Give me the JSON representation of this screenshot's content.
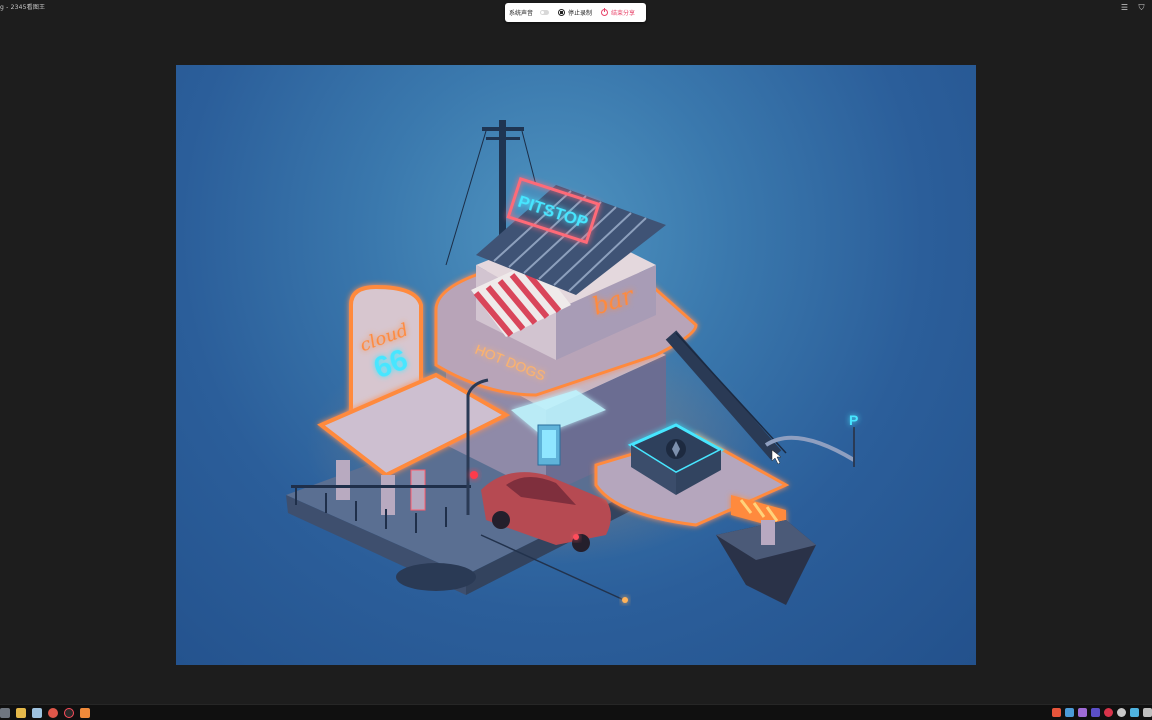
{
  "window": {
    "title": "g - 2345看图王"
  },
  "recorder": {
    "system_sound_label": "系统声音",
    "stop_label": "停止录制",
    "end_share_label": "结束分享",
    "colors": {
      "end": "#e8456b"
    }
  },
  "artwork": {
    "signs": {
      "pitstop": "PITSTOP",
      "bar": "bar",
      "cloud": "cloud",
      "number": "66",
      "hotdogs": "HOT DOGS",
      "parking": "P"
    },
    "colors": {
      "background": "#2b5e9a",
      "neon_orange": "#ff8a3d",
      "neon_pink": "#ff5a6a",
      "neon_cyan": "#47e6ff"
    }
  },
  "top_right_icons": [
    "menu-icon",
    "shield-icon"
  ],
  "taskbar": {
    "left_icons": [
      "start-icon",
      "folder-icon",
      "files-icon",
      "chrome-icon",
      "recorder-icon",
      "app-icon"
    ],
    "tray_icons": [
      "s-icon",
      "grid-icon",
      "check-icon",
      "a-icon",
      "red-circle-icon",
      "circle-icon",
      "monitor-icon",
      "network-icon"
    ]
  }
}
